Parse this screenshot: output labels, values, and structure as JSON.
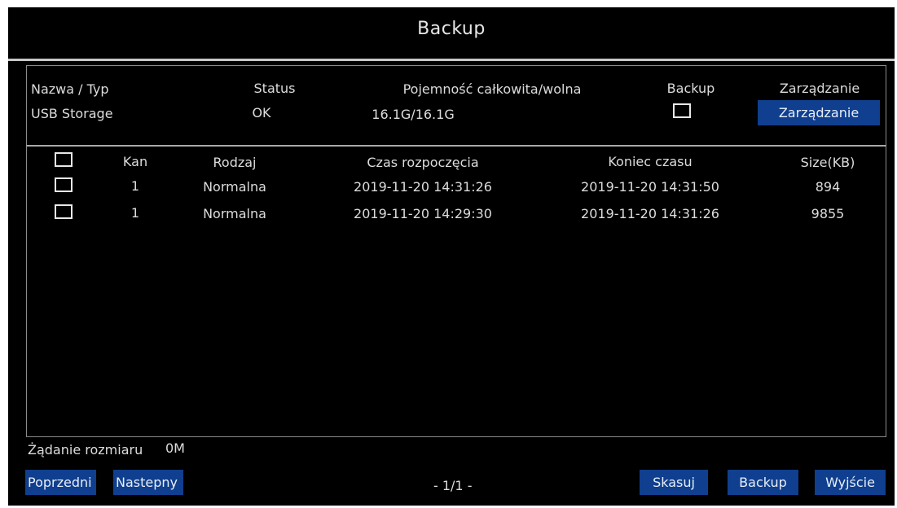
{
  "window": {
    "title": "Backup"
  },
  "device_table": {
    "headers": {
      "name": "Nazwa / Typ",
      "status": "Status",
      "capacity": "Pojemność całkowita/wolna",
      "backup": "Backup",
      "manage": "Zarządzanie"
    },
    "rows": [
      {
        "name": "USB Storage",
        "status": "OK",
        "capacity": "16.1G/16.1G",
        "backup_checked": false,
        "manage_label": "Zarządzanie"
      }
    ]
  },
  "file_table": {
    "headers": {
      "channel": "Kan",
      "type": "Rodzaj",
      "start": "Czas rozpoczęcia",
      "end": "Koniec czasu",
      "size": "Size(KB)"
    },
    "rows": [
      {
        "checked": false,
        "channel": "1",
        "type": "Normalna",
        "start": "2019-11-20 14:31:26",
        "end": "2019-11-20 14:31:50",
        "size": "894"
      },
      {
        "checked": false,
        "channel": "1",
        "type": "Normalna",
        "start": "2019-11-20 14:29:30",
        "end": "2019-11-20 14:31:26",
        "size": "9855"
      }
    ]
  },
  "footer": {
    "size_request_label": "Żądanie rozmiaru",
    "size_request_value": "0M",
    "prev_label": "Poprzedni",
    "next_label": "Nastepny",
    "pagination": "- 1/1 -",
    "delete_label": "Skasuj",
    "backup_label": "Backup",
    "exit_label": "Wyjście"
  },
  "colors": {
    "background": "#000000",
    "button": "#0f3f8e",
    "text": "#dcdcdc",
    "border": "#8a8a8a"
  }
}
